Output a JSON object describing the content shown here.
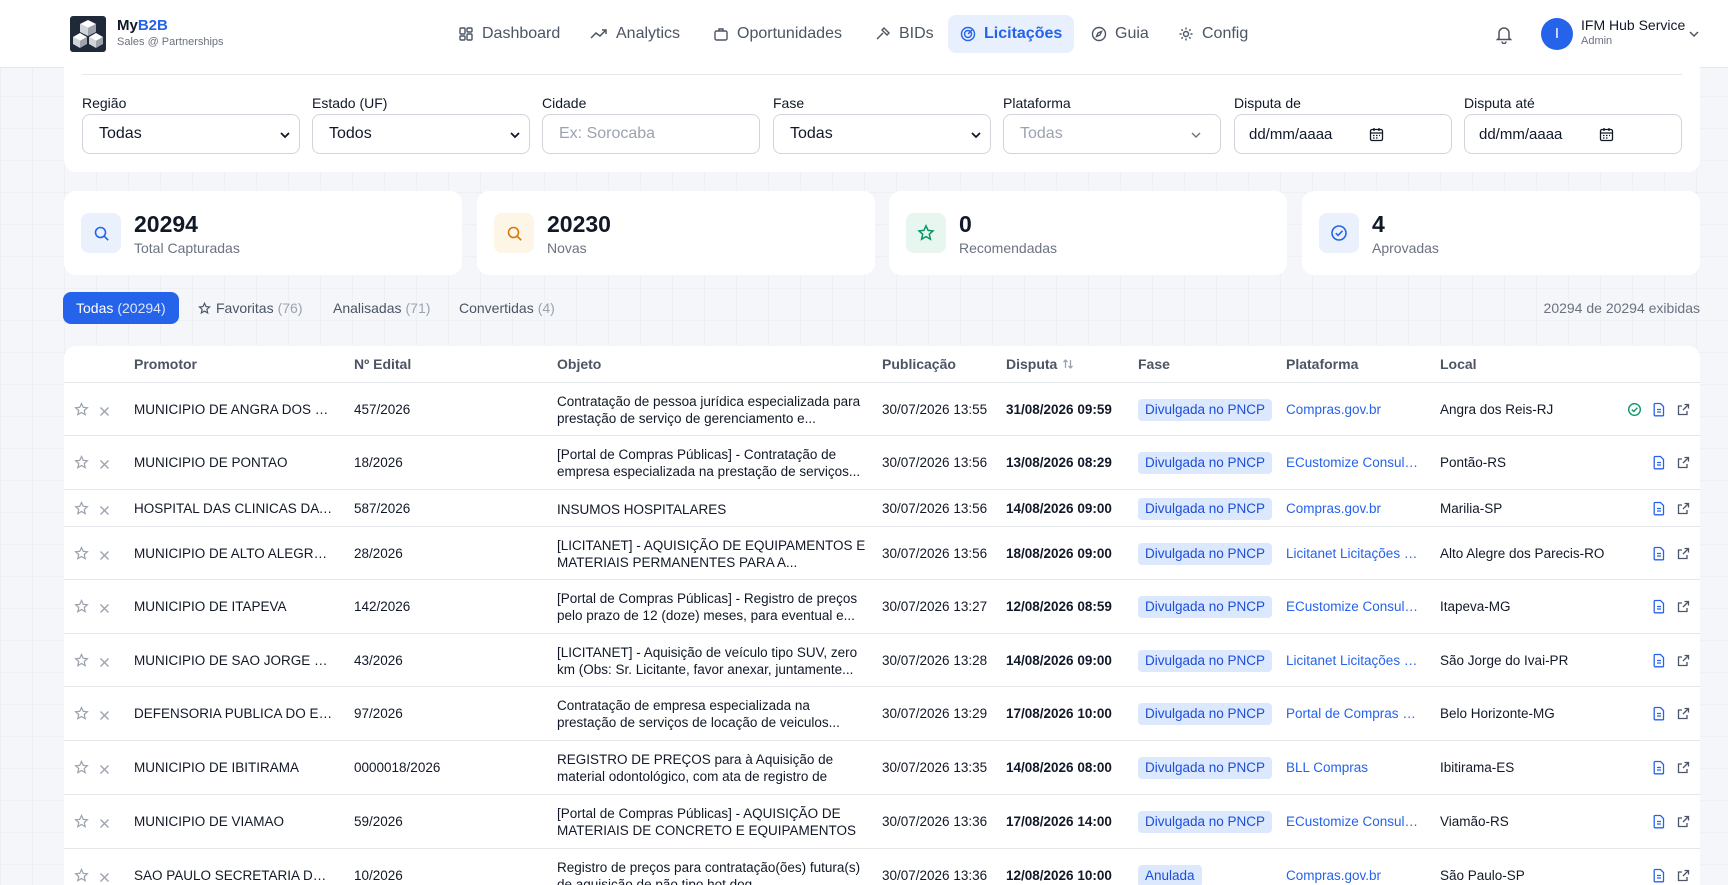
{
  "brand": {
    "name_prefix": "My",
    "name_suffix": "B2B",
    "subtitle": "Sales @ Partnerships"
  },
  "nav": [
    {
      "label": "Dashboard",
      "icon": "dashboard-icon"
    },
    {
      "label": "Analytics",
      "icon": "trend-icon"
    },
    {
      "label": "Oportunidades",
      "icon": "briefcase-icon"
    },
    {
      "label": "BIDs",
      "icon": "gavel-icon"
    },
    {
      "label": "Licitações",
      "icon": "radar-icon",
      "active": true
    },
    {
      "label": "Guia",
      "icon": "compass-icon"
    },
    {
      "label": "Config",
      "icon": "gear-icon"
    }
  ],
  "user": {
    "initial": "I",
    "name": "IFM Hub Service",
    "role": "Admin"
  },
  "filters": {
    "regiao": {
      "label": "Região",
      "value": "Todas"
    },
    "estado": {
      "label": "Estado (UF)",
      "value": "Todos"
    },
    "cidade": {
      "label": "Cidade",
      "placeholder": "Ex: Sorocaba"
    },
    "fase": {
      "label": "Fase",
      "value": "Todas"
    },
    "plataforma": {
      "label": "Plataforma",
      "value": "Todas"
    },
    "disputa_de": {
      "label": "Disputa de",
      "value": "dd/mm/aaaa"
    },
    "disputa_ate": {
      "label": "Disputa até",
      "value": "dd/mm/aaaa"
    }
  },
  "stats": [
    {
      "value": "20294",
      "label": "Total Capturadas",
      "icon": "search-icon",
      "color": "#2563eb",
      "bg": "#eaf1fd"
    },
    {
      "value": "20230",
      "label": "Novas",
      "icon": "search-icon",
      "color": "#d97706",
      "bg": "#fdf6e7"
    },
    {
      "value": "0",
      "label": "Recomendadas",
      "icon": "star-icon",
      "color": "#059669",
      "bg": "#e7f7ef"
    },
    {
      "value": "4",
      "label": "Aprovadas",
      "icon": "check-circle-icon",
      "color": "#2563eb",
      "bg": "#eaf1fd"
    }
  ],
  "tabs": [
    {
      "label": "Todas",
      "count": "(20294)",
      "active": true
    },
    {
      "label": "Favoritas",
      "count": "(76)"
    },
    {
      "label": "Analisadas",
      "count": "(71)"
    },
    {
      "label": "Convertidas",
      "count": "(4)"
    }
  ],
  "shown_text": "20294 de 20294 exibidas",
  "table": {
    "headers": {
      "promotor": "Promotor",
      "edital": "Nº Edital",
      "objeto": "Objeto",
      "publicacao": "Publicação",
      "disputa": "Disputa",
      "fase": "Fase",
      "plataforma": "Plataforma",
      "local": "Local"
    },
    "rows": [
      {
        "promotor": "MUNICIPIO DE ANGRA DOS REIS",
        "edital": "457/2026",
        "objeto": "Contratação de pessoa jurídica especializada para prestação de serviço de gerenciamento e...",
        "publicacao": "30/07/2026 13:55",
        "disputa": "31/08/2026 09:59",
        "fase": "Divulgada no PNCP",
        "plataforma": "Compras.gov.br",
        "local": "Angra dos Reis-RJ",
        "approved": true
      },
      {
        "promotor": "MUNICIPIO DE PONTAO",
        "edital": "18/2026",
        "objeto": "[Portal de Compras Públicas] - Contratação de empresa especializada na prestação de serviços...",
        "publicacao": "30/07/2026 13:56",
        "disputa": "13/08/2026 08:29",
        "fase": "Divulgada no PNCP",
        "plataforma": "ECustomize Consultoria em Software",
        "local": "Pontão-RS"
      },
      {
        "promotor": "HOSPITAL DAS CLINICAS DA FACULDADE DE MEDICINA DE MARILIA",
        "edital": "587/2026",
        "objeto": "INSUMOS HOSPITALARES",
        "publicacao": "30/07/2026 13:56",
        "disputa": "14/08/2026 09:00",
        "fase": "Divulgada no PNCP",
        "plataforma": "Compras.gov.br",
        "local": "Marilia-SP"
      },
      {
        "promotor": "MUNICIPIO DE ALTO ALEGRE DOS PARECIS",
        "edital": "28/2026",
        "objeto": "[LICITANET] - AQUISIÇÃO DE EQUIPAMENTOS E MATERIAIS PERMANENTES PARA A...",
        "publicacao": "30/07/2026 13:56",
        "disputa": "18/08/2026 09:00",
        "fase": "Divulgada no PNCP",
        "plataforma": "Licitanet Licitações Eletrônicas",
        "local": "Alto Alegre dos Parecis-RO"
      },
      {
        "promotor": "MUNICIPIO DE ITAPEVA",
        "edital": "142/2026",
        "objeto": "[Portal de Compras Públicas] - Registro de preços pelo prazo de 12 (doze) meses, para eventual e...",
        "publicacao": "30/07/2026 13:27",
        "disputa": "12/08/2026 08:59",
        "fase": "Divulgada no PNCP",
        "plataforma": "ECustomize Consultoria em Software",
        "local": "Itapeva-MG"
      },
      {
        "promotor": "MUNICIPIO DE SAO JORGE DO IVAI",
        "edital": "43/2026",
        "objeto": "[LICITANET] - Aquisição de veículo tipo SUV, zero km (Obs: Sr. Licitante, favor anexar, juntamente...",
        "publicacao": "30/07/2026 13:28",
        "disputa": "14/08/2026 09:00",
        "fase": "Divulgada no PNCP",
        "plataforma": "Licitanet Licitações Eletrônicas",
        "local": "São Jorge do Ivai-PR"
      },
      {
        "promotor": "DEFENSORIA PUBLICA DO ESTADO DE MINAS GERAIS",
        "edital": "97/2026",
        "objeto": "Contratação de empresa especializada na prestação de serviços de locação de veiculos...",
        "publicacao": "30/07/2026 13:29",
        "disputa": "17/08/2026 10:00",
        "fase": "Divulgada no PNCP",
        "plataforma": "Portal de Compras de Minas Gerais",
        "local": "Belo Horizonte-MG"
      },
      {
        "promotor": "MUNICIPIO DE IBITIRAMA",
        "edital": "0000018/2026",
        "objeto": "REGISTRO DE PREÇOS para à Aquisição de material odontológico, com ata de registro de preço, para...",
        "publicacao": "30/07/2026 13:35",
        "disputa": "14/08/2026 08:00",
        "fase": "Divulgada no PNCP",
        "plataforma": "BLL Compras",
        "local": "Ibitirama-ES"
      },
      {
        "promotor": "MUNICIPIO DE VIAMAO",
        "edital": "59/2026",
        "objeto": "[Portal de Compras Públicas] - AQUISIÇÃO DE MATERIAIS DE CONCRETO E EQUIPAMENTOS",
        "publicacao": "30/07/2026 13:36",
        "disputa": "17/08/2026 14:00",
        "fase": "Divulgada no PNCP",
        "plataforma": "ECustomize Consultoria em Software",
        "local": "Viamão-RS"
      },
      {
        "promotor": "SAO PAULO SECRETARIA DA EDUCACAO",
        "edital": "10/2026",
        "objeto": "Registro de preços para contratação(ões) futura(s) de aquisição de pão tipo hot dog...",
        "publicacao": "30/07/2026 13:36",
        "disputa": "12/08/2026 10:00",
        "fase": "Anulada",
        "plataforma": "Compras.gov.br",
        "local": "São Paulo-SP"
      }
    ]
  }
}
